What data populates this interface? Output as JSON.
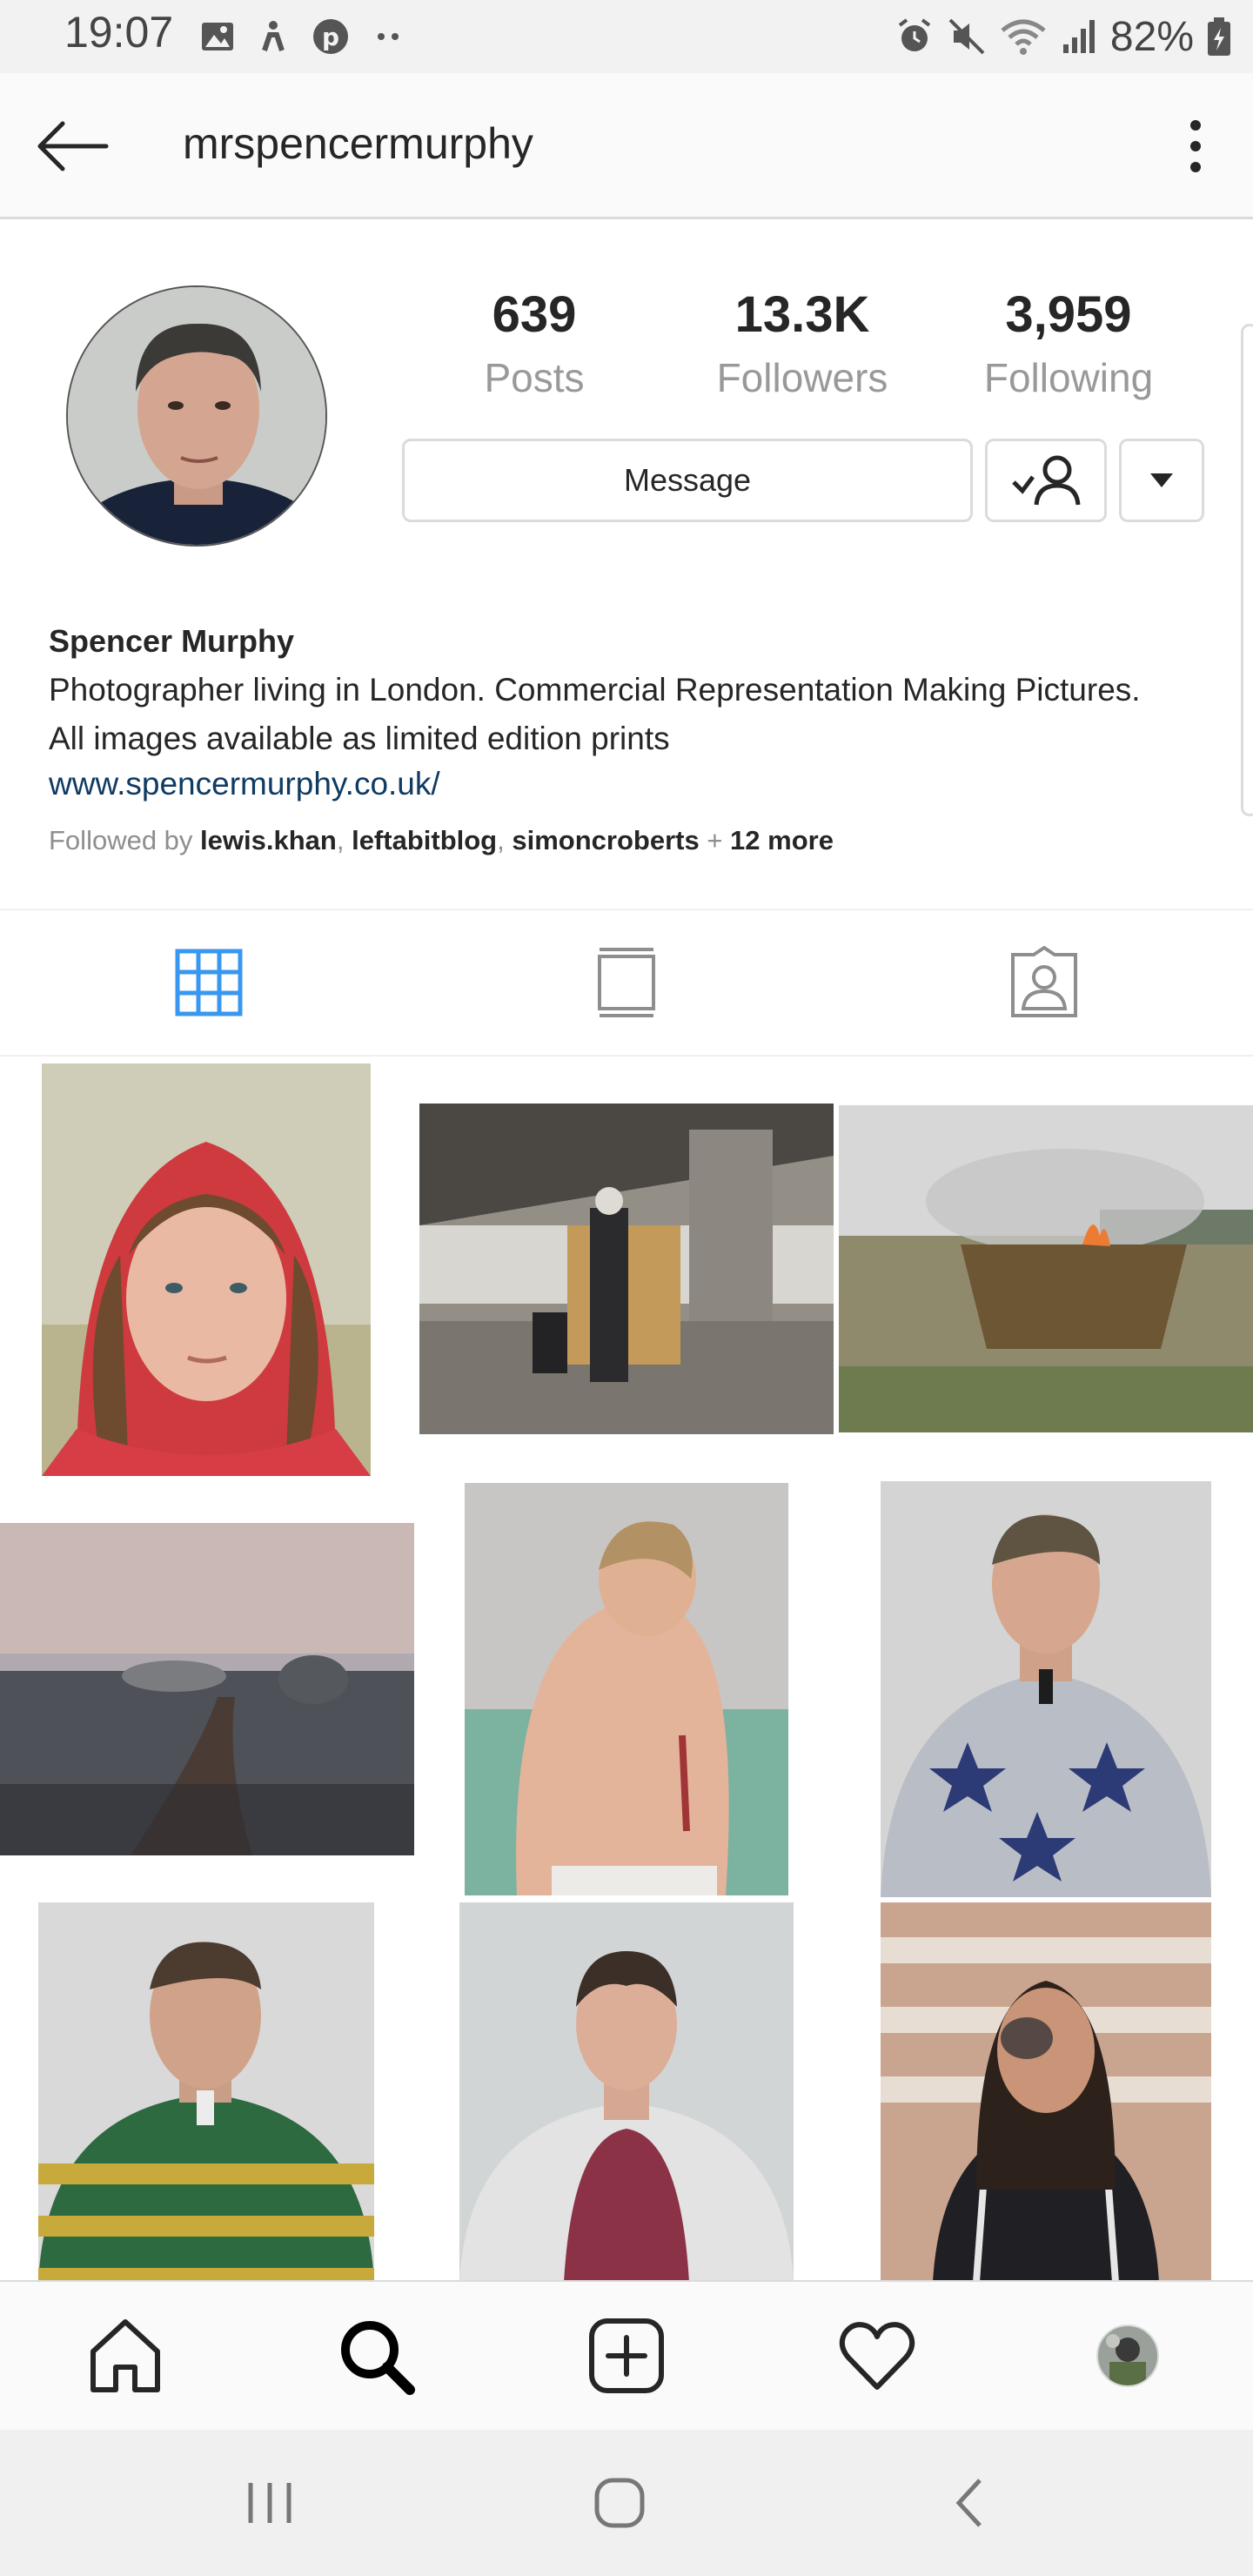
{
  "status_bar": {
    "time": "19:07",
    "battery": "82%"
  },
  "header": {
    "username": "mrspencermurphy"
  },
  "stats": [
    {
      "value": "639",
      "label": "Posts"
    },
    {
      "value": "13.3K",
      "label": "Followers"
    },
    {
      "value": "3,959",
      "label": "Following"
    }
  ],
  "actions": {
    "message_label": "Message"
  },
  "bio": {
    "name": "Spencer Murphy",
    "line1": "Photographer living in London. Commercial Representation Making Pictures.",
    "line2": "All images available as limited edition prints",
    "link": "www.spencermurphy.co.uk/",
    "followed_prefix": "Followed by",
    "followers": [
      "lewis.khan",
      "leftabitblog",
      "simoncroberts"
    ],
    "followed_more": "12 more"
  },
  "tabs": [
    {
      "icon": "grid-icon",
      "active": true
    },
    {
      "icon": "feed-icon",
      "active": false
    },
    {
      "icon": "tagged-icon",
      "active": false
    }
  ],
  "colors": {
    "active_tab": "#3897f0",
    "link": "#0f3b63",
    "muted": "#8e8e8e"
  }
}
